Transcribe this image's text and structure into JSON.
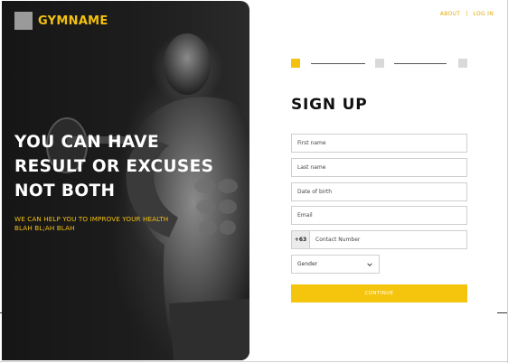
{
  "brand": {
    "name": "GYMNAME"
  },
  "hero": {
    "headline_lines": [
      "YOU CAN HAVE",
      "RESULT OR EXCUSES",
      "NOT BOTH"
    ],
    "subline_lines": [
      "WE CAN HELP YOU TO IMPROVE YOUR HEALTH",
      "BLAH BL;AH BLAH"
    ]
  },
  "nav": {
    "about": "ABOUT",
    "separator": "|",
    "login": "LOG IN"
  },
  "stepper": {
    "current_step": 1,
    "total_steps": 3
  },
  "form": {
    "title": "SIGN UP",
    "first_name": {
      "placeholder": "First name",
      "value": ""
    },
    "last_name": {
      "placeholder": "Last name",
      "value": ""
    },
    "dob": {
      "placeholder": "Date of birth",
      "value": ""
    },
    "email": {
      "placeholder": "Email",
      "value": ""
    },
    "phone": {
      "prefix": "+63",
      "placeholder": "Contact Number",
      "value": ""
    },
    "gender": {
      "selected": "Gender"
    },
    "continue_label": "CONTINUE"
  },
  "colors": {
    "accent": "#f4c10f",
    "hero_bg": "#1b1b1b"
  }
}
